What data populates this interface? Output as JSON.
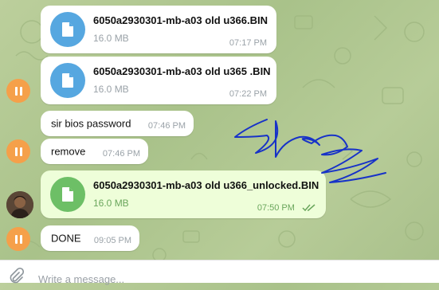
{
  "colors": {
    "file_icon_incoming": "#56a7e0",
    "file_icon_outgoing": "#6dbf66",
    "pause_avatar": "#f5a04a",
    "signature_ink": "#1732c8"
  },
  "messages": [
    {
      "type": "file",
      "name": "6050a2930301-mb-a03 old u366.BIN",
      "size": "16.0 MB",
      "time": "07:17 PM",
      "icon": "document-icon"
    },
    {
      "type": "file",
      "name": "6050a2930301-mb-a03 old u365 .BIN",
      "size": "16.0 MB",
      "time": "07:22 PM",
      "icon": "document-icon"
    },
    {
      "type": "text",
      "text": "sir bios password",
      "time": "07:46 PM"
    },
    {
      "type": "text",
      "text": "remove",
      "time": "07:46 PM"
    },
    {
      "type": "file",
      "name": "6050a2930301-mb-a03 old u366_unlocked.BIN",
      "size": "16.0 MB",
      "time": "07:50 PM",
      "icon": "document-icon"
    },
    {
      "type": "text",
      "text": "DONE",
      "time": "09:05 PM"
    }
  ],
  "composer": {
    "placeholder": "Write a message..."
  }
}
